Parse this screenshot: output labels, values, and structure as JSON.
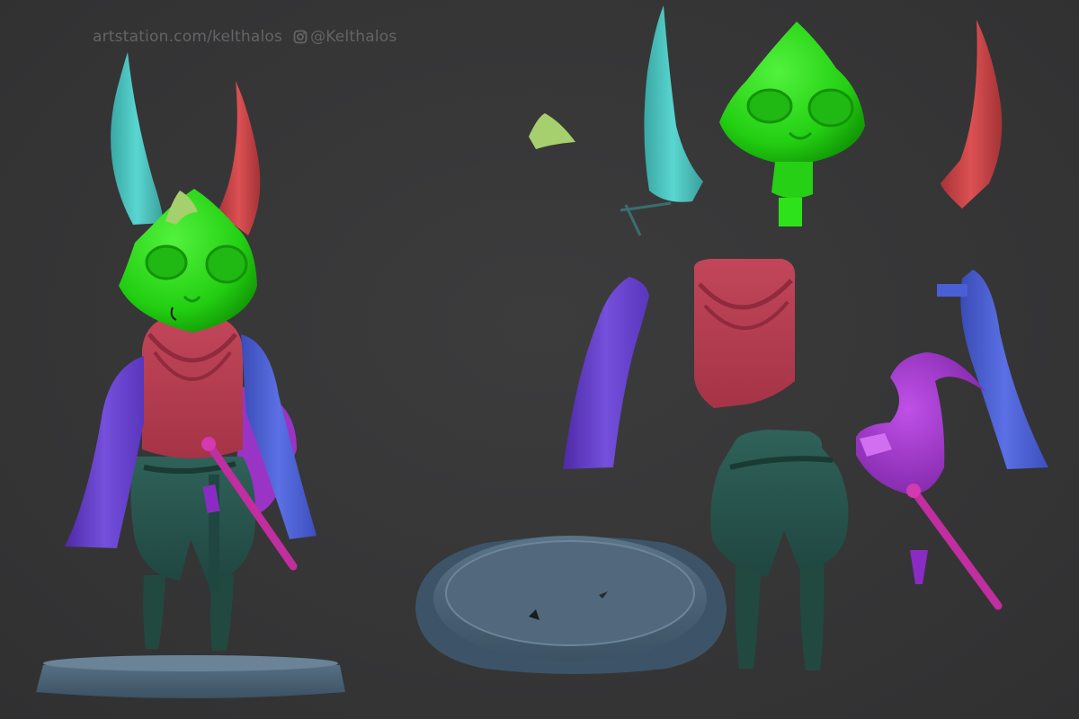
{
  "watermark": {
    "site": "artstation.com/kelthalos",
    "handle": "@Kelthalos",
    "icon": "instagram-icon"
  },
  "colors": {
    "background": "#363637",
    "watermark_text": "#646466",
    "horn_teal": "#4fc9c4",
    "horn_red": "#d4474a",
    "head_green": "#2ee21b",
    "scarf_red": "#b83e4f",
    "sleeve_left_purple": "#6a3fd0",
    "sleeve_right_blue": "#4a5fd6",
    "pants_teal": "#2a5a52",
    "base_slate": "#4a6478",
    "hat_magenta": "#a43ad0",
    "flute_pink": "#c02ea0",
    "hair_tuft": "#a6cf6e"
  }
}
